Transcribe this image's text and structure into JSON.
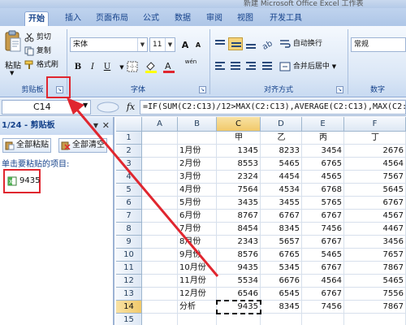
{
  "window": {
    "title_fragment": "新建 Microsoft Office Excel 工作表"
  },
  "tabs": [
    {
      "label": "开始",
      "active": true
    },
    {
      "label": "插入"
    },
    {
      "label": "页面布局"
    },
    {
      "label": "公式"
    },
    {
      "label": "数据"
    },
    {
      "label": "审阅"
    },
    {
      "label": "视图"
    },
    {
      "label": "开发工具"
    }
  ],
  "clipboard_group": {
    "paste": "粘贴",
    "cut": "剪切",
    "copy": "复制",
    "format_painter": "格式刷",
    "label": "剪贴板"
  },
  "font_group": {
    "font_name": "宋体",
    "font_size": "11",
    "label": "字体",
    "bold": "B",
    "italic": "I",
    "underline": "U",
    "grow": "A",
    "shrink": "A",
    "wen": "wén"
  },
  "align_group": {
    "wrap": "自动换行",
    "merge": "合并后居中",
    "label": "对齐方式"
  },
  "number_group": {
    "format": "常规",
    "label": "数字"
  },
  "formula_bar": {
    "name_box": "C14",
    "fx": "fx",
    "formula": "=IF(SUM(C2:C13)/12>MAX(C2:C13),AVERAGE(C2:C13),MAX(C2:C"
  },
  "clipboard_pane": {
    "title": "1/24 - 剪贴板",
    "paste_all": "全部粘贴",
    "clear_all": "全部清空",
    "hint": "单击要粘贴的项目:",
    "items": [
      "9435"
    ]
  },
  "sheet": {
    "columns": [
      "A",
      "B",
      "C",
      "D",
      "E",
      "F"
    ],
    "selected_column": "C",
    "selected_row": "14",
    "rows": [
      {
        "n": "1",
        "b": "",
        "c": "甲",
        "d": "乙",
        "e": "丙",
        "f": "丁"
      },
      {
        "n": "2",
        "b": "1月份",
        "c": "1345",
        "d": "8233",
        "e": "3454",
        "f": "2676"
      },
      {
        "n": "3",
        "b": "2月份",
        "c": "8553",
        "d": "5465",
        "e": "6765",
        "f": "4564"
      },
      {
        "n": "4",
        "b": "3月份",
        "c": "2324",
        "d": "4454",
        "e": "4565",
        "f": "7567"
      },
      {
        "n": "5",
        "b": "4月份",
        "c": "7564",
        "d": "4534",
        "e": "6768",
        "f": "5645"
      },
      {
        "n": "6",
        "b": "5月份",
        "c": "3435",
        "d": "3455",
        "e": "5765",
        "f": "6767"
      },
      {
        "n": "7",
        "b": "6月份",
        "c": "8767",
        "d": "6767",
        "e": "6767",
        "f": "4567"
      },
      {
        "n": "8",
        "b": "7月份",
        "c": "8454",
        "d": "8345",
        "e": "7456",
        "f": "4467"
      },
      {
        "n": "9",
        "b": "8月份",
        "c": "2343",
        "d": "5657",
        "e": "6767",
        "f": "3456"
      },
      {
        "n": "10",
        "b": "9月份",
        "c": "8576",
        "d": "6765",
        "e": "5465",
        "f": "7657"
      },
      {
        "n": "11",
        "b": "10月份",
        "c": "9435",
        "d": "5345",
        "e": "6767",
        "f": "7867"
      },
      {
        "n": "12",
        "b": "11月份",
        "c": "5534",
        "d": "6676",
        "e": "4564",
        "f": "5465"
      },
      {
        "n": "13",
        "b": "12月份",
        "c": "6546",
        "d": "6545",
        "e": "6767",
        "f": "7556"
      },
      {
        "n": "14",
        "b": "分析",
        "c": "9435",
        "d": "8345",
        "e": "7456",
        "f": "7867"
      },
      {
        "n": "15",
        "b": "",
        "c": "",
        "d": "",
        "e": "",
        "f": ""
      }
    ]
  },
  "colors": {
    "annotation_red": "#e0262f",
    "ribbon_blue": "#15428b",
    "selected_header": "#f1c96a"
  }
}
